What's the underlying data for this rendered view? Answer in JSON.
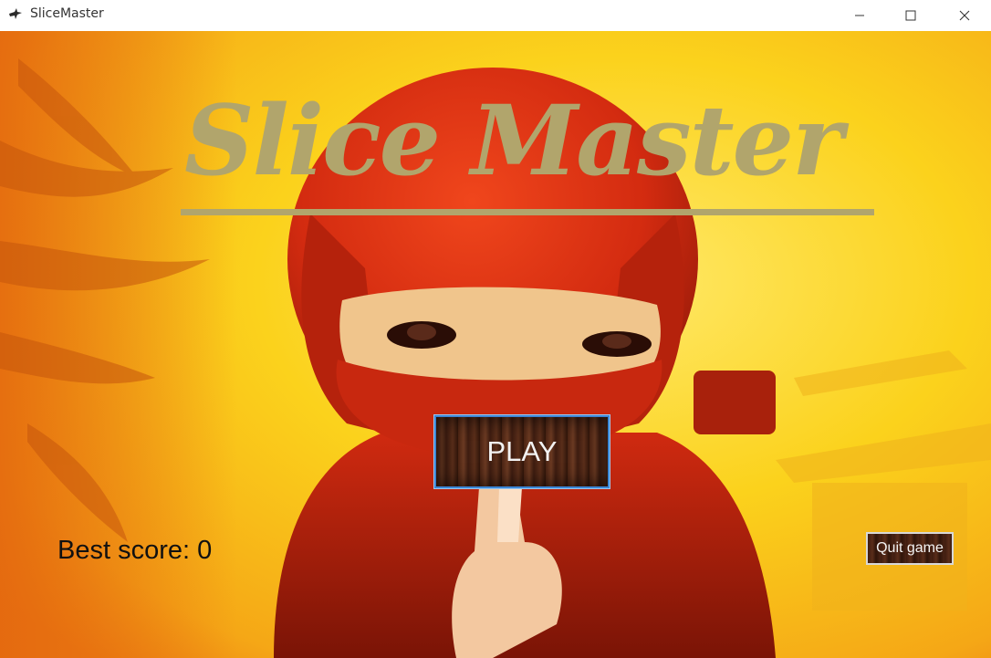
{
  "window": {
    "title": "SliceMaster",
    "icon": "ninja-star-icon"
  },
  "window_controls": {
    "minimize_icon": "minimize-icon",
    "maximize_icon": "maximize-icon",
    "close_icon": "close-icon"
  },
  "game": {
    "logo_text": "Slice Master",
    "play_label": "PLAY",
    "best_score_label": "Best score: 0",
    "best_score_value": 0,
    "quit_label": "Quit game"
  },
  "colors": {
    "logo": "#b1a56c",
    "play_border": "#3a86d6",
    "background_main": "#f7d21a",
    "ninja_red": "#d22a10"
  }
}
